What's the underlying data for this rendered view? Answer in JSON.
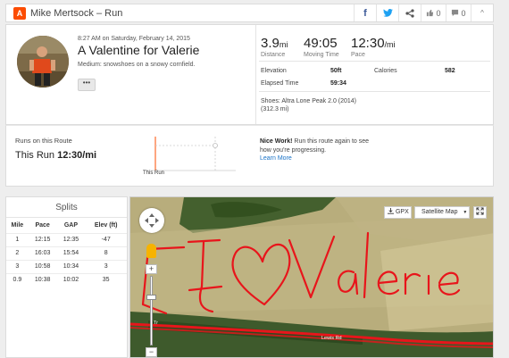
{
  "header": {
    "logo": "A",
    "title": "Mike Mertsock – Run",
    "icons": {
      "facebook": "f",
      "twitter": "t",
      "share": "share-icon"
    },
    "kudos_count": "0",
    "comment_count": "0",
    "collapse": "^"
  },
  "activity": {
    "datetime": "8:27 AM on Saturday, February 14, 2015",
    "title": "A Valentine for Valerie",
    "description": "Medium: snowshoes on a snowy cornfield.",
    "more_label": "•••"
  },
  "stats": {
    "distance_value": "3.9",
    "distance_unit": "mi",
    "distance_label": "Distance",
    "moving_time_value": "49:05",
    "moving_time_label": "Moving Time",
    "pace_value": "12:30",
    "pace_unit": "/mi",
    "pace_label": "Pace",
    "elevation_label": "Elevation",
    "elevation_value": "50ft",
    "calories_label": "Calories",
    "calories_value": "582",
    "elapsed_label": "Elapsed Time",
    "elapsed_value": "59:34",
    "shoes": "Shoes: Altra Lone Peak 2.0 (2014)",
    "shoes_distance": "(312.3 mi)"
  },
  "route": {
    "label": "Runs on this Route",
    "this_run_prefix": "This Run ",
    "this_run_pace": "12:30/mi",
    "chart_caption": "This Run",
    "nice_bold": "Nice Work!",
    "nice_text": " Run this route again to see how you're progressing.",
    "learn_more": "Learn More"
  },
  "splits": {
    "title": "Splits",
    "columns": [
      "Mile",
      "Pace",
      "GAP",
      "Elev (ft)"
    ],
    "rows": [
      [
        "1",
        "12:15",
        "12:35",
        "-47"
      ],
      [
        "2",
        "16:03",
        "15:54",
        "8"
      ],
      [
        "3",
        "10:58",
        "10:34",
        "3"
      ],
      [
        "0.9",
        "10:38",
        "10:02",
        "35"
      ]
    ]
  },
  "map": {
    "gpx_label": "GPX",
    "map_type": "Satellite Map",
    "road_label_1": "Tr",
    "road_label_2": "Lewis Rd",
    "colors": {
      "route": "#e8151b",
      "field": "#b7aa78",
      "trees": "#3d5a2a"
    }
  }
}
